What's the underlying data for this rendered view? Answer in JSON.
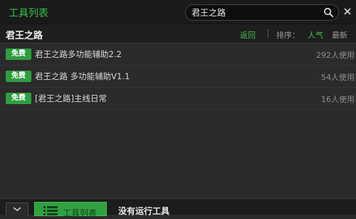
{
  "app": {
    "title": "工具列表",
    "close_icon": "close-icon"
  },
  "search": {
    "value": "君王之路",
    "icon": "search-icon"
  },
  "header": {
    "title": "君王之路",
    "back_label": "返回",
    "sort_label": "排序：",
    "sort_popular": "人气",
    "sort_newest": "最新"
  },
  "tools": [
    {
      "badge": "免费",
      "name": "君王之路多功能辅助2.2",
      "users": "292人使用"
    },
    {
      "badge": "免费",
      "name": "君王之路 多功能辅助V1.1",
      "users": "54人使用"
    },
    {
      "badge": "免费",
      "name": "[君王之路]主线日常",
      "users": "16人使用"
    }
  ],
  "footer": {
    "tools_button_label": "工具列表",
    "status": "没有运行工具"
  },
  "colors": {
    "accent": "#37c24a",
    "badge": "#2e9e3f",
    "background": "#2b2b2b"
  }
}
